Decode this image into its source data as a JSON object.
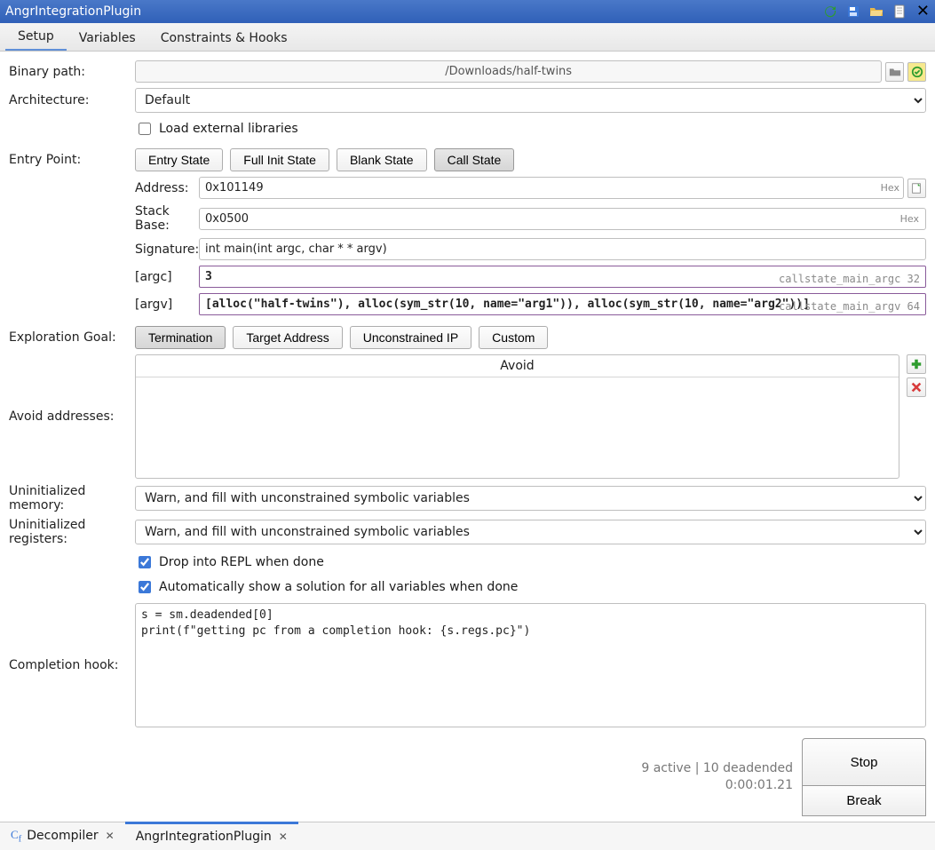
{
  "title": "AngrIntegrationPlugin",
  "tabs": {
    "setup": "Setup",
    "variables": "Variables",
    "constraints": "Constraints & Hooks"
  },
  "labels": {
    "binary_path": "Binary path:",
    "architecture": "Architecture:",
    "load_external": "Load external libraries",
    "entry_point": "Entry Point:",
    "address": "Address:",
    "stack_base": "Stack Base:",
    "signature": "Signature:",
    "argc": "[argc]",
    "argv": "[argv]",
    "exploration_goal": "Exploration Goal:",
    "avoid_addresses": "Avoid addresses:",
    "avoid_header": "Avoid",
    "uninit_mem": "Uninitialized memory:",
    "uninit_reg": "Uninitialized registers:",
    "drop_repl": "Drop into REPL when done",
    "auto_solution": "Automatically show a solution for all variables when done",
    "completion_hook": "Completion hook:",
    "hex": "Hex"
  },
  "values": {
    "binary_path": "/Downloads/half-twins",
    "architecture": "Default",
    "address": "0x101149",
    "stack_base": "0x0500",
    "signature": "int main(int argc, char * * argv)",
    "argc": "3",
    "argc_tag": "callstate_main_argc 32",
    "argv": "[alloc(\"half-twins\"), alloc(sym_str(10, name=\"arg1\")), alloc(sym_str(10, name=\"arg2\"))]",
    "argv_tag": "callstate_main_argv 64",
    "uninit_mem": "Warn, and fill with unconstrained symbolic variables",
    "uninit_reg": "Warn, and fill with unconstrained symbolic variables",
    "completion_hook": "s = sm.deadended[0]\nprint(f\"getting pc from a completion hook: {s.regs.pc}\")"
  },
  "entry_buttons": {
    "entry_state": "Entry State",
    "full_init": "Full Init State",
    "blank_state": "Blank State",
    "call_state": "Call State"
  },
  "goal_buttons": {
    "termination": "Termination",
    "target_address": "Target Address",
    "unconstrained_ip": "Unconstrained IP",
    "custom": "Custom"
  },
  "status": {
    "line1": "9 active | 10 deadended",
    "line2": "0:00:01.21"
  },
  "action_buttons": {
    "stop": "Stop",
    "break": "Break"
  },
  "dock": {
    "decompiler": "Decompiler",
    "plugin": "AngrIntegrationPlugin"
  }
}
